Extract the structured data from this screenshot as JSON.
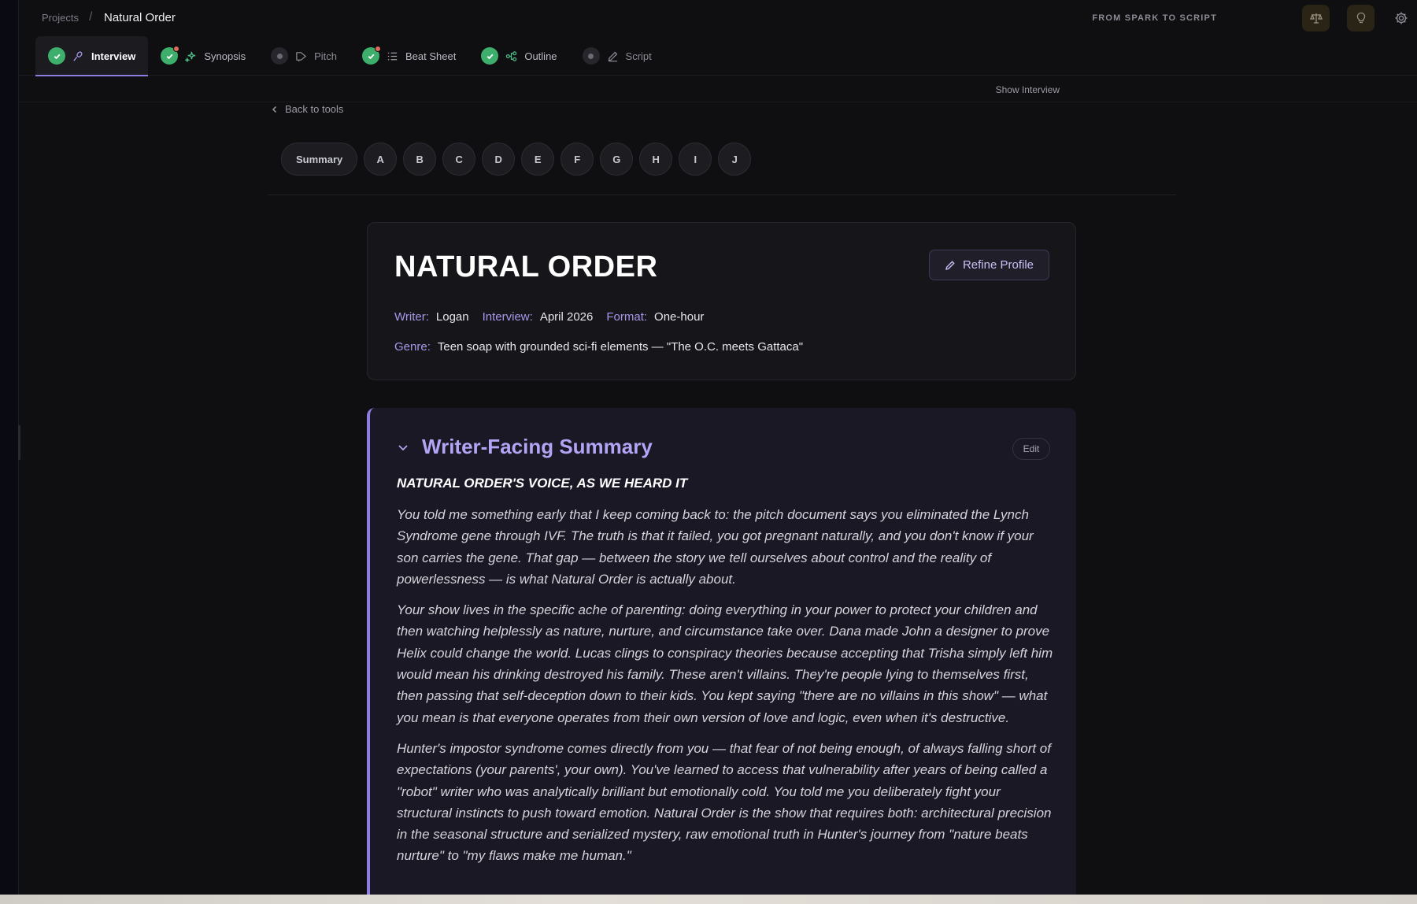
{
  "breadcrumb": {
    "parent": "Projects",
    "separator": "/",
    "current": "Natural Order"
  },
  "brand": "FROM SPARK TO SCRIPT",
  "tabs": [
    {
      "label": "Interview",
      "status": "done",
      "icon": "microphone-icon",
      "active": true
    },
    {
      "label": "Synopsis",
      "status": "done",
      "icon": "sparkle-icon",
      "badge": true
    },
    {
      "label": "Pitch",
      "status": "pending",
      "icon": "projector-icon"
    },
    {
      "label": "Beat Sheet",
      "status": "done",
      "icon": "list-icon",
      "badge": true
    },
    {
      "label": "Outline",
      "status": "done",
      "icon": "nodes-icon"
    },
    {
      "label": "Script",
      "status": "pending",
      "icon": "pencil-icon"
    }
  ],
  "subbar": {
    "show_interview": "Show Interview"
  },
  "back_label": "Back to tools",
  "section_pills": [
    "Summary",
    "A",
    "B",
    "C",
    "D",
    "E",
    "F",
    "G",
    "H",
    "I",
    "J"
  ],
  "profile": {
    "title": "NATURAL ORDER",
    "refine_label": "Refine Profile",
    "writer_label": "Writer:",
    "writer": "Logan",
    "interview_label": "Interview:",
    "interview": "April 2026",
    "format_label": "Format:",
    "format": "One-hour",
    "genre_label": "Genre:",
    "genre": "Teen soap with grounded sci-fi elements — \"The O.C. meets Gattaca\""
  },
  "summary": {
    "title": "Writer-Facing Summary",
    "edit_label": "Edit",
    "subheading": "NATURAL ORDER'S VOICE, AS WE HEARD IT",
    "paragraphs": [
      "You told me something early that I keep coming back to: the pitch document says you eliminated the Lynch Syndrome gene through IVF. The truth is that it failed, you got pregnant naturally, and you don't know if your son carries the gene. That gap — between the story we tell ourselves about control and the reality of powerlessness — is what Natural Order is actually about.",
      "Your show lives in the specific ache of parenting: doing everything in your power to protect your children and then watching helplessly as nature, nurture, and circumstance take over. Dana made John a designer to prove Helix could change the world. Lucas clings to conspiracy theories because accepting that Trisha simply left him would mean his drinking destroyed his family. These aren't villains. They're people lying to themselves first, then passing that self-deception down to their kids. You kept saying \"there are no villains in this show\" — what you mean is that everyone operates from their own version of love and logic, even when it's destructive.",
      "Hunter's impostor syndrome comes directly from you — that fear of not being enough, of always falling short of expectations (your parents', your own). You've learned to access that vulnerability after years of being called a \"robot\" writer who was analytically brilliant but emotionally cold. You told me you deliberately fight your structural instincts to push toward emotion. Natural Order is the show that requires both: architectural precision in the seasonal structure and serialized mystery, raw emotional truth in Hunter's journey from \"nature beats nurture\" to \"my flaws make me human.\""
    ]
  },
  "colors": {
    "accent": "#8f7ce0",
    "accent_text": "#b3a4f5",
    "success": "#3dae6c",
    "background": "#0f0f11"
  }
}
